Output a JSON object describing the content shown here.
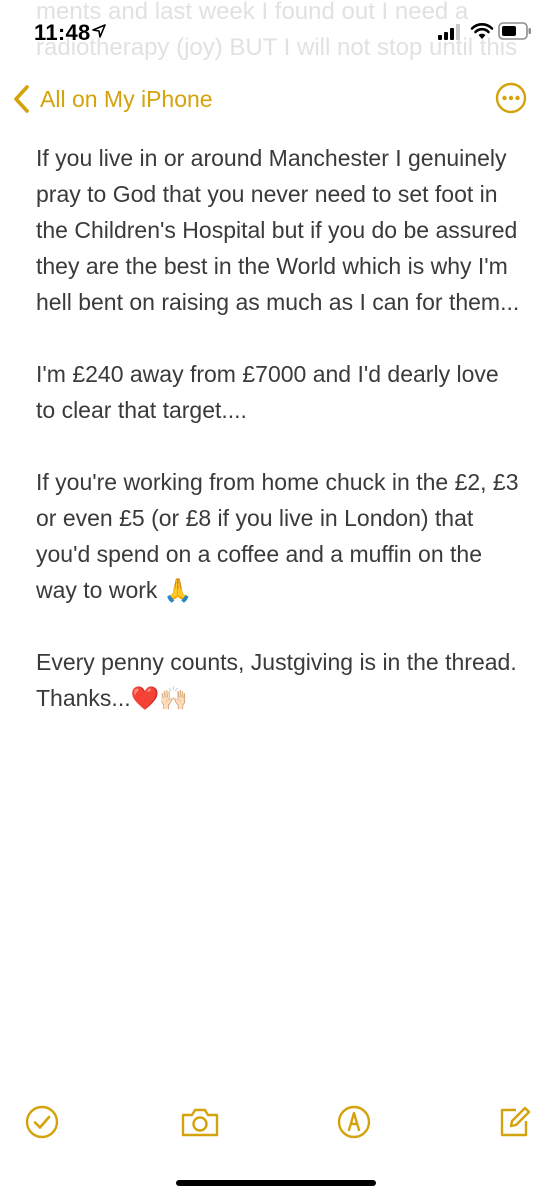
{
  "status_bar": {
    "time": "11:48",
    "ghost_text": "ments and last week I found out I need a radiotherapy (joy) BUT I will not stop until this"
  },
  "nav": {
    "back_label": "All on My iPhone",
    "accent_color": "#d4a20a"
  },
  "note": {
    "paragraphs": [
      "If you live in or around Manchester I genuinely pray to God that you never need to set foot in the Children's Hospital but if you do be assured they are the best in the World which is why I'm hell bent on raising as much as I can for them...",
      "I'm £240 away from £7000 and I'd dearly love to clear that target....",
      "If you're working from home chuck in the £2, £3 or even £5 (or £8 if you live in London) that you'd spend on a coffee and a muffin on the way to work 🙏",
      "Every penny counts, Justgiving is in the thread. Thanks...❤️🙌🏻"
    ]
  },
  "toolbar": {
    "icons": [
      "checklist-icon",
      "camera-icon",
      "markup-icon",
      "compose-icon"
    ]
  }
}
